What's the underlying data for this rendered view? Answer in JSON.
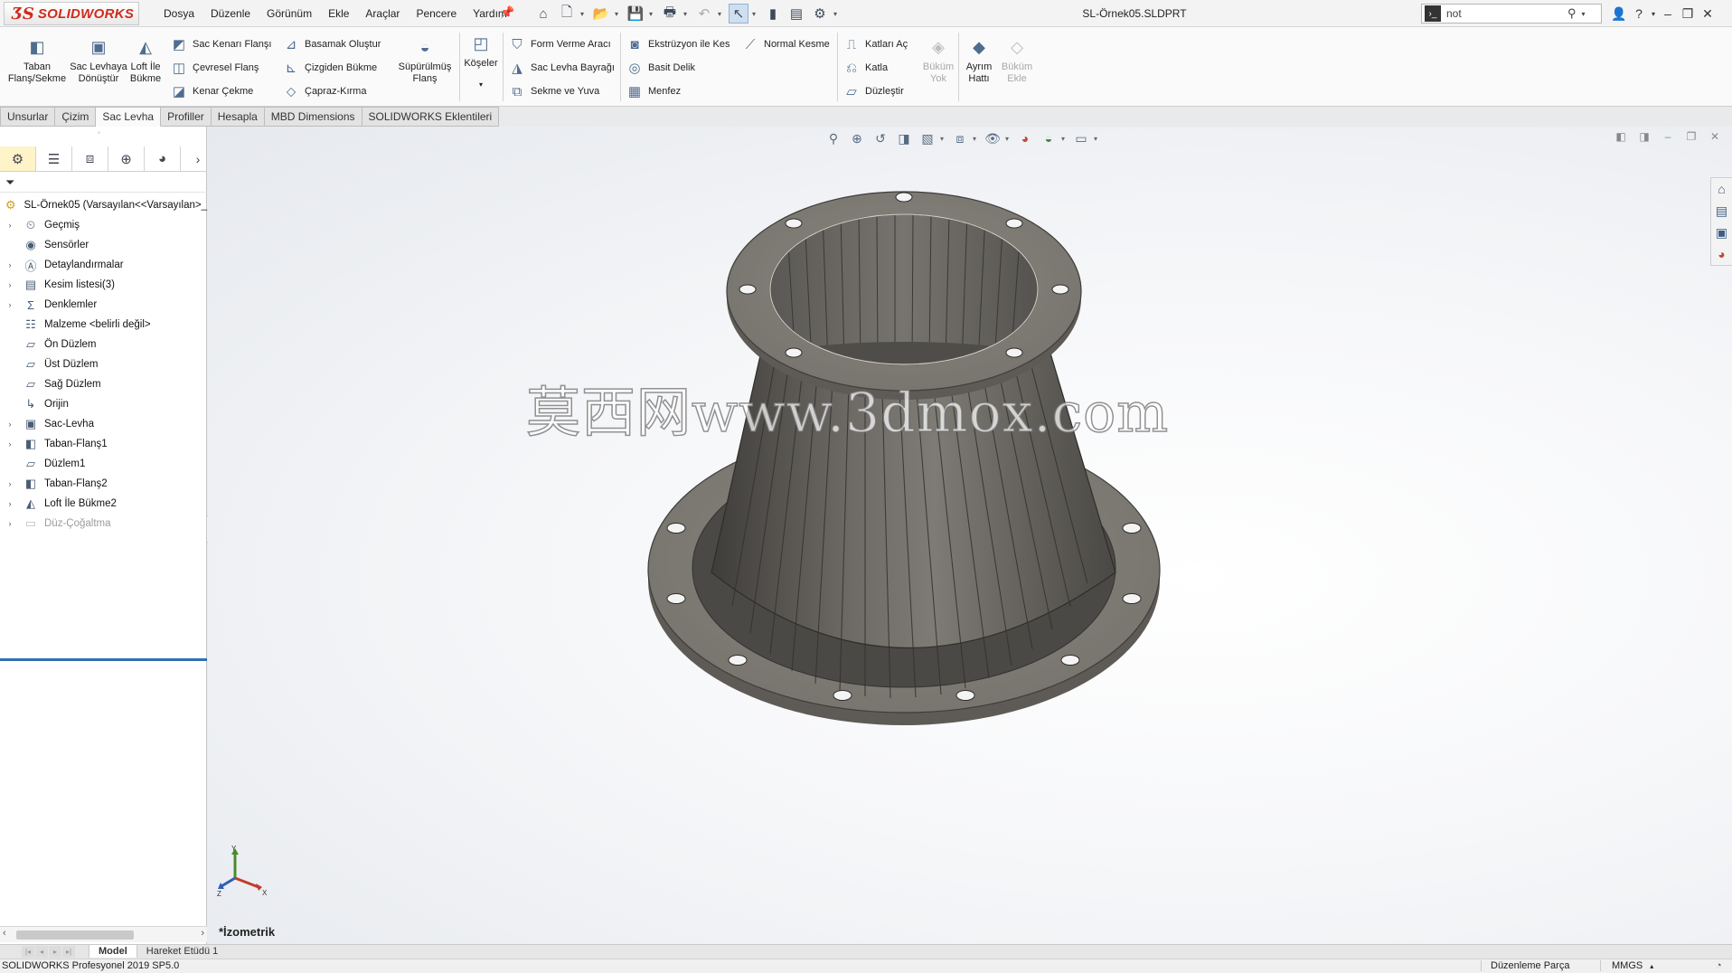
{
  "app": {
    "logo_symbol": "ƷS",
    "logo_name": "SOLIDWORKS",
    "document_title": "SL-Örnek05.SLDPRT"
  },
  "menu": [
    "Dosya",
    "Düzenle",
    "Görünüm",
    "Ekle",
    "Araçlar",
    "Pencere",
    "Yardım"
  ],
  "search": {
    "value": "not"
  },
  "command_manager": {
    "big_buttons": [
      {
        "label": "Taban Flanş/Sekme",
        "icon": "base-flange-icon"
      },
      {
        "label": "Sac Levhaya Dönüştür",
        "icon": "convert-to-sheet-metal-icon"
      },
      {
        "label": "Loft İle Bükme",
        "icon": "lofted-bend-icon"
      },
      {
        "label": "Süpürülmüş Flanş",
        "icon": "swept-flange-icon"
      },
      {
        "label": "Köşeler",
        "icon": "corners-icon"
      },
      {
        "label": "Büküm Yok",
        "icon": "no-bends-icon",
        "disabled": true
      },
      {
        "label": "Ayrım Hattı",
        "icon": "rip-icon"
      },
      {
        "label": "Büküm Ekle",
        "icon": "insert-bends-icon",
        "disabled": true
      }
    ],
    "col1": [
      "Sac Kenarı Flanşı",
      "Çevresel Flanş",
      "Kenar Çekme"
    ],
    "col2": [
      "Basamak Oluştur",
      "Çizgiden Bükme",
      "Çapraz-Kırma"
    ],
    "col3": [
      "Form Verme Aracı",
      "Sac Levha Bayrağı",
      "Sekme ve Yuva"
    ],
    "col4": [
      "Ekstrüzyon ile Kes",
      "Basit Delik",
      "Menfez"
    ],
    "col5": [
      "Normal Kesme"
    ],
    "col6": [
      "Katları Aç",
      "Katla",
      "Düzleştir"
    ]
  },
  "tabs": [
    "Unsurlar",
    "Çizim",
    "Sac Levha",
    "Profiller",
    "Hesapla",
    "MBD Dimensions",
    "SOLIDWORKS Eklentileri"
  ],
  "active_tab": "Sac Levha",
  "feature_tree": {
    "root": "SL-Örnek05  (Varsayılan<<Varsayılan>_",
    "items": [
      {
        "label": "Geçmiş",
        "icon": "history-icon",
        "expandable": true
      },
      {
        "label": "Sensörler",
        "icon": "sensors-icon",
        "expandable": false
      },
      {
        "label": "Detaylandırmalar",
        "icon": "annotations-icon",
        "expandable": true
      },
      {
        "label": "Kesim listesi(3)",
        "icon": "cut-list-icon",
        "expandable": true
      },
      {
        "label": "Denklemler",
        "icon": "equations-icon",
        "expandable": true
      },
      {
        "label": "Malzeme <belirli değil>",
        "icon": "material-icon",
        "expandable": false
      },
      {
        "label": "Ön Düzlem",
        "icon": "plane-icon",
        "expandable": false
      },
      {
        "label": "Üst Düzlem",
        "icon": "plane-icon",
        "expandable": false
      },
      {
        "label": "Sağ Düzlem",
        "icon": "plane-icon",
        "expandable": false
      },
      {
        "label": "Orijin",
        "icon": "origin-icon",
        "expandable": false
      },
      {
        "label": "Sac-Levha",
        "icon": "sheet-metal-icon",
        "expandable": true
      },
      {
        "label": "Taban-Flanş1",
        "icon": "base-flange-icon",
        "expandable": true
      },
      {
        "label": "Düzlem1",
        "icon": "plane-icon",
        "expandable": false
      },
      {
        "label": "Taban-Flanş2",
        "icon": "base-flange-icon",
        "expandable": true
      },
      {
        "label": "Loft İle Bükme2",
        "icon": "lofted-bend-icon",
        "expandable": true
      },
      {
        "label": "Düz-Çoğaltma",
        "icon": "flat-pattern-icon",
        "expandable": true,
        "suppressed": true
      }
    ]
  },
  "viewport": {
    "watermark": "莫西网www.3dmox.com",
    "view_name": "*İzometrik",
    "triad": {
      "x": "X",
      "y": "Y",
      "z": "Z"
    }
  },
  "bottom_tabs": [
    "Model",
    "Hareket Etüdü 1"
  ],
  "status": {
    "version": "SOLIDWORKS Profesyonel 2019 SP5.0",
    "mode": "Düzenleme Parça",
    "units": "MMGS"
  },
  "colors": {
    "brand": "#d12a1c",
    "selection_bar": "#2f6fb3",
    "model_gray": "#7b7870"
  }
}
